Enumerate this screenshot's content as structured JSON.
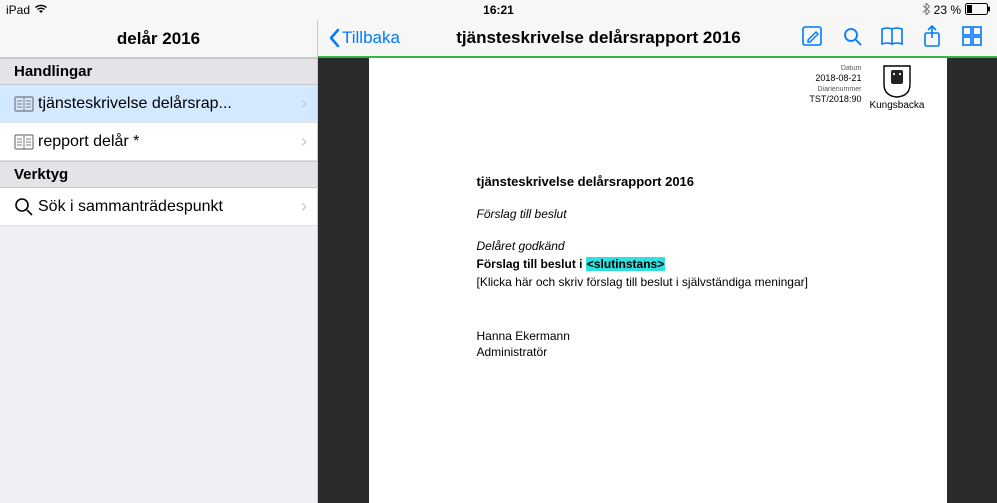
{
  "status": {
    "device": "iPad",
    "time": "16:21",
    "battery_text": "23 %"
  },
  "sidebar": {
    "title": "delår 2016",
    "sections": [
      {
        "header": "Handlingar"
      },
      {
        "header": "Verktyg"
      }
    ],
    "items": {
      "doc1": "tjänsteskrivelse delårsrap...",
      "doc2": "repport delår *",
      "search": "Sök i sammanträdespunkt"
    }
  },
  "toolbar": {
    "back_label": "Tillbaka",
    "doc_title": "tjänsteskrivelse delårsrapport 2016"
  },
  "document": {
    "meta": {
      "date_label": "Datum",
      "date": "2018-08-21",
      "diary_label": "Diarienummer",
      "diary": "TST/2018:90",
      "municipality": "Kungsbacka"
    },
    "title": "tjänsteskrivelse delårsrapport 2016",
    "proposal_heading": "Förslag till beslut",
    "approved_line": "Delåret godkänd",
    "proposal_bold": "Förslag till beslut i ",
    "proposal_highlight": "<slutinstans>",
    "hint": "[Klicka här och skriv förslag till beslut i självständiga meningar]",
    "signer_name": "Hanna Ekermann",
    "signer_title": "Administratör"
  }
}
